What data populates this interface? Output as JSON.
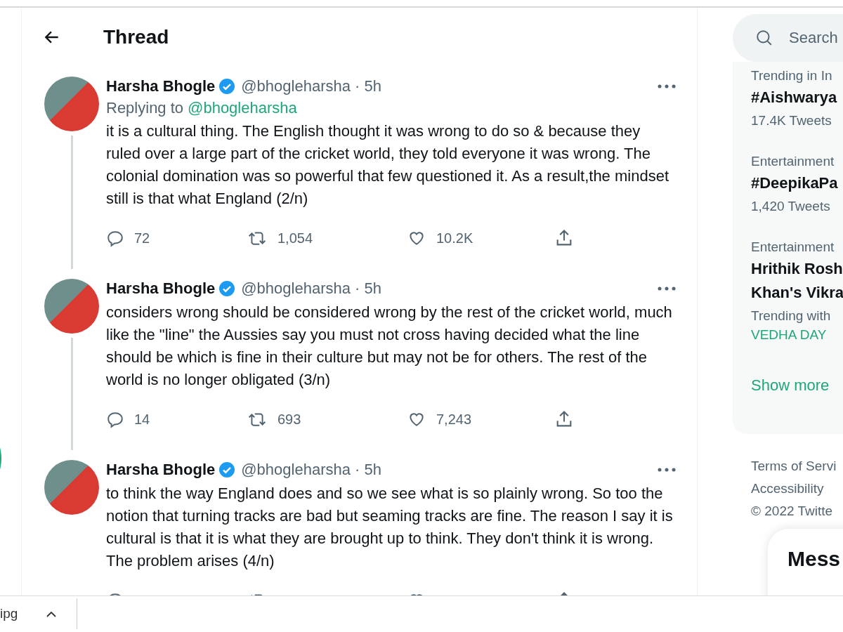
{
  "header": {
    "title": "Thread"
  },
  "tweets": [
    {
      "name": "Harsha Bhogle",
      "verified": true,
      "meta": "@bhogleharsha · 5h",
      "replying_label": "Replying to",
      "replying_to": "@bhogleharsha",
      "text": "it is a cultural thing. The English thought it was wrong to do so & because they ruled over a large part of the cricket world, they told everyone it was wrong. The colonial domination was so powerful that few questioned it. As a result,the mindset still is that what England (2/n)",
      "replies": "72",
      "retweets": "1,054",
      "likes": "10.2K"
    },
    {
      "name": "Harsha Bhogle",
      "verified": true,
      "meta": "@bhogleharsha · 5h",
      "text": "considers wrong should be considered wrong by the rest of the cricket world, much like the \"line\" the Aussies say you must not cross having decided what the line should be which is fine in their culture but may not be for others. The rest of the world is no longer obligated (3/n)",
      "replies": "14",
      "retweets": "693",
      "likes": "7,243"
    },
    {
      "name": "Harsha Bhogle",
      "verified": true,
      "meta": "@bhogleharsha · 5h",
      "text": "to think the way England does and so we see what is so plainly wrong. So too the notion that turning tracks are bad but seaming tracks are fine. The reason I say it is cultural is that it is what they are brought up to think. They don't think it is wrong. The problem arises (4/n)"
    }
  ],
  "search": {
    "placeholder": "Search"
  },
  "trends": [
    {
      "context": "Trending in In",
      "title": "#Aishwarya",
      "count": "17.4K Tweets"
    },
    {
      "context": "Entertainment",
      "title": "#DeepikaPa",
      "count": "1,420 Tweets"
    },
    {
      "context": "Entertainment",
      "title": "Hrithik Rosh Khan's Vikra",
      "with_label": "Trending with",
      "with_tag": "VEDHA DAY"
    }
  ],
  "show_more": "Show more",
  "footer_links": [
    "Terms of Servi",
    "Accessibility",
    "© 2022 Twitte"
  ],
  "messages": {
    "title": "Mess"
  },
  "download": {
    "file": "ipg"
  }
}
